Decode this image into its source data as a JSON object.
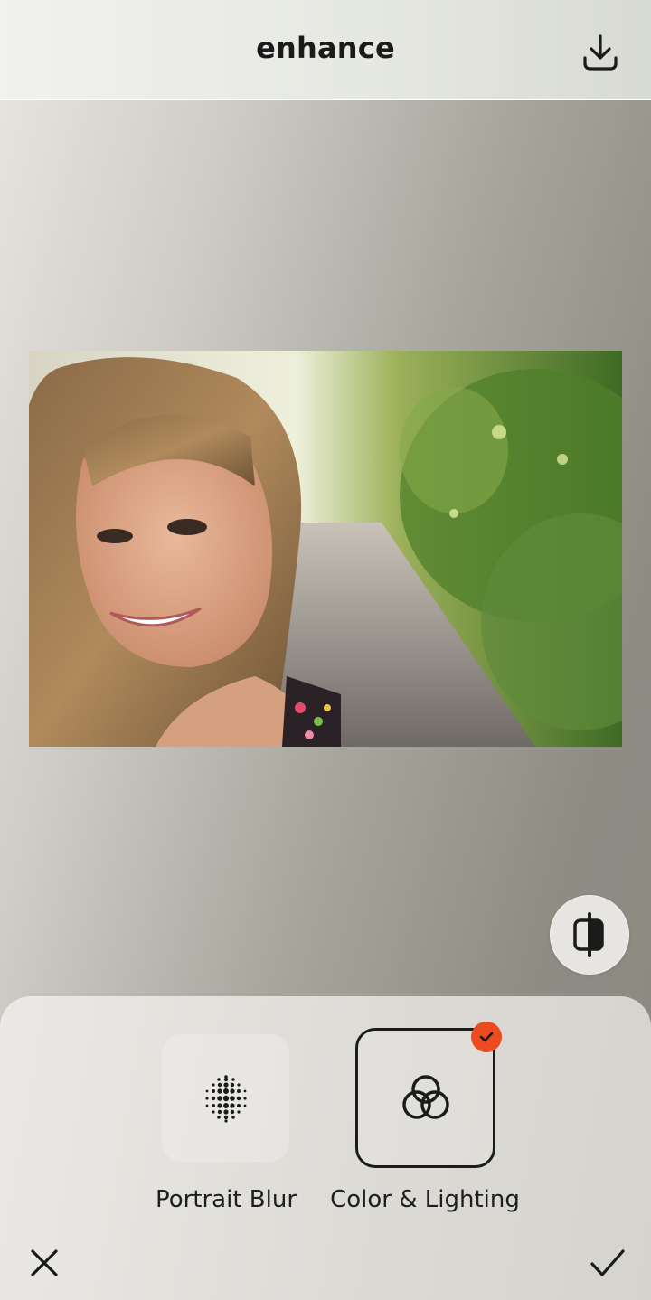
{
  "header": {
    "title": "enhance",
    "download_icon": "download-icon"
  },
  "photo": {
    "subject": "smiling-woman-portrait"
  },
  "compare": {
    "icon": "compare-split-icon"
  },
  "tools": {
    "items": [
      {
        "label": "Portrait Blur",
        "icon": "dot-grid-icon",
        "selected": false
      },
      {
        "label": "Color & Lighting",
        "icon": "interlocking-rings-icon",
        "selected": true
      }
    ],
    "badge_color": "#ec4a1f"
  },
  "actions": {
    "close_icon": "close-icon",
    "apply_icon": "checkmark-icon"
  }
}
